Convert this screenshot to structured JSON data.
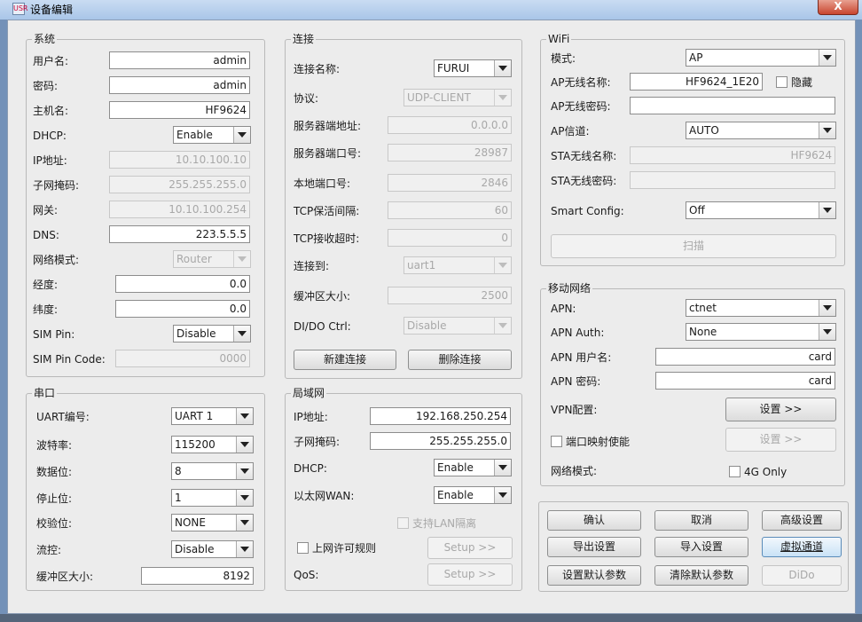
{
  "window": {
    "title": "设备编辑",
    "close_glyph": "X",
    "app_icon_text": "USR"
  },
  "system": {
    "title": "系统",
    "username_label": "用户名:",
    "username": "admin",
    "password_label": "密码:",
    "password": "admin",
    "hostname_label": "主机名:",
    "hostname": "HF9624",
    "dhcp_label": "DHCP:",
    "dhcp": "Enable",
    "ip_label": "IP地址:",
    "ip": "10.10.100.10",
    "mask_label": "子网掩码:",
    "mask": "255.255.255.0",
    "gateway_label": "网关:",
    "gateway": "10.10.100.254",
    "dns_label": "DNS:",
    "dns": "223.5.5.5",
    "netmode_label": "网络模式:",
    "netmode": "Router",
    "lon_label": "经度:",
    "lon": "0.0",
    "lat_label": "纬度:",
    "lat": "0.0",
    "simpin_label": "SIM Pin:",
    "simpin": "Disable",
    "simpincode_label": "SIM Pin Code:",
    "simpincode": "0000"
  },
  "serial": {
    "title": "串口",
    "uart_label": "UART编号:",
    "uart": "UART 1",
    "baud_label": "波特率:",
    "baud": "115200",
    "databits_label": "数据位:",
    "databits": "8",
    "stopbits_label": "停止位:",
    "stopbits": "1",
    "parity_label": "校验位:",
    "parity": "NONE",
    "flow_label": "流控:",
    "flow": "Disable",
    "buffer_label": "缓冲区大小:",
    "buffer": "8192"
  },
  "connection": {
    "title": "连接",
    "name_label": "连接名称:",
    "name": "FURUI",
    "protocol_label": "协议:",
    "protocol": "UDP-CLIENT",
    "server_addr_label": "服务器端地址:",
    "server_addr": "0.0.0.0",
    "server_port_label": "服务器端口号:",
    "server_port": "28987",
    "local_port_label": "本地端口号:",
    "local_port": "2846",
    "keepalive_label": "TCP保活间隔:",
    "keepalive": "60",
    "timeout_label": "TCP接收超时:",
    "timeout": "0",
    "connect_to_label": "连接到:",
    "connect_to": "uart1",
    "buffer_label": "缓冲区大小:",
    "buffer": "2500",
    "dido_label": "DI/DO Ctrl:",
    "dido": "Disable",
    "new_btn": "新建连接",
    "del_btn": "删除连接"
  },
  "lan": {
    "title": "局域网",
    "ip_label": "IP地址:",
    "ip": "192.168.250.254",
    "mask_label": "子网掩码:",
    "mask": "255.255.255.0",
    "dhcp_label": "DHCP:",
    "dhcp": "Enable",
    "wan_label": "以太网WAN:",
    "wan": "Enable",
    "lan_isolate_label": "支持LAN隔离",
    "rules_label": "上网许可规则",
    "rules_setup": "Setup >>",
    "qos_label": "QoS:",
    "qos_setup": "Setup >>"
  },
  "wifi": {
    "title": "WiFi",
    "mode_label": "模式:",
    "mode": "AP",
    "ap_ssid_label": "AP无线名称:",
    "ap_ssid": "HF9624_1E20",
    "hide_label": "隐藏",
    "ap_pwd_label": "AP无线密码:",
    "ap_pwd": "",
    "channel_label": "AP信道:",
    "channel": "AUTO",
    "sta_ssid_label": "STA无线名称:",
    "sta_ssid": "HF9624",
    "sta_pwd_label": "STA无线密码:",
    "sta_pwd": "",
    "smart_label": "Smart Config:",
    "smart": "Off",
    "scan_btn": "扫描"
  },
  "mobile": {
    "title": "移动网络",
    "apn_label": "APN:",
    "apn": "ctnet",
    "auth_label": "APN Auth:",
    "auth": "None",
    "user_label": "APN 用户名:",
    "user": "card",
    "pwd_label": "APN 密码:",
    "pwd": "card",
    "vpn_label": "VPN配置:",
    "vpn_btn": "设置 >>",
    "portmap_label": "端口映射使能",
    "portmap_btn": "设置 >>",
    "netmode_label": "网络模式:",
    "only4g_label": "4G Only"
  },
  "actions": {
    "ok": "确认",
    "cancel": "取消",
    "advanced": "高级设置",
    "export": "导出设置",
    "import": "导入设置",
    "virtual": "虚拟通道",
    "set_default": "设置默认参数",
    "clear_default": "清除默认参数",
    "dido": "DiDo"
  }
}
